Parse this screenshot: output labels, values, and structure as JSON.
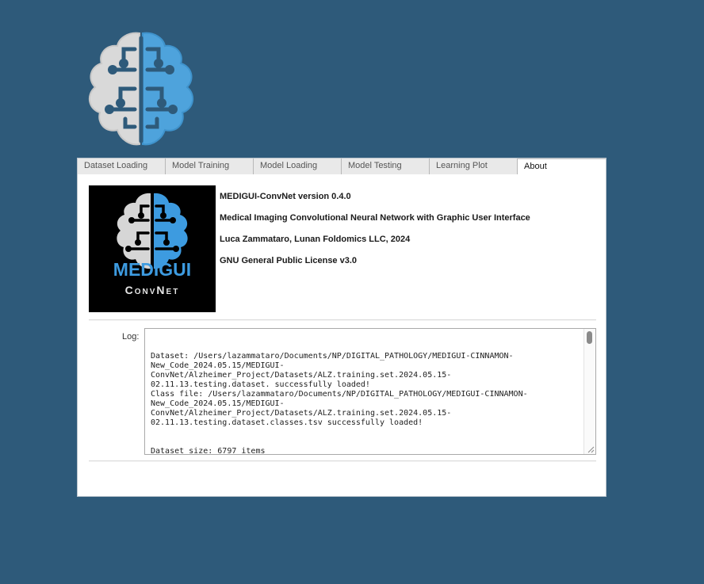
{
  "app_logo": {
    "icon": "brain-icon",
    "colors": {
      "left_half": "#d9d9d9",
      "right_half": "#4ea3dc"
    }
  },
  "tabs": [
    {
      "label": "Dataset Loading",
      "active": false
    },
    {
      "label": "Model Training",
      "active": false
    },
    {
      "label": "Model Loading",
      "active": false
    },
    {
      "label": "Model Testing",
      "active": false
    },
    {
      "label": "Learning Plot",
      "active": false
    },
    {
      "label": "About",
      "active": true
    }
  ],
  "about": {
    "logo": {
      "word1": "MEDIGUI",
      "word2": "ConvNet",
      "word1_color": "#3d9be0",
      "word2_color": "#e6e6e6"
    },
    "version": "MEDIGUI-ConvNet version 0.4.0",
    "description": "Medical Imaging Convolutional Neural Network with Graphic User Interface",
    "author": "Luca Zammataro, Lunan Foldomics LLC, 2024",
    "license": "GNU General Public License v3.0"
  },
  "log": {
    "label": "Log:",
    "lines": [
      "",
      "",
      "Dataset: /Users/lazammataro/Documents/NP/DIGITAL_PATHOLOGY/MEDIGUI-CINNAMON-",
      "New_Code_2024.05.15/MEDIGUI-",
      "ConvNet/Alzheimer_Project/Datasets/ALZ.training.set.2024.05.15-",
      "02.11.13.testing.dataset. successfully loaded!",
      "Class file: /Users/lazammataro/Documents/NP/DIGITAL_PATHOLOGY/MEDIGUI-CINNAMON-",
      "New_Code_2024.05.15/MEDIGUI-",
      "ConvNet/Alzheimer_Project/Datasets/ALZ.training.set.2024.05.15-",
      "02.11.13.testing.dataset.classes.tsv successfully loaded!",
      "",
      "",
      "Dataset size: 6797 items"
    ]
  }
}
